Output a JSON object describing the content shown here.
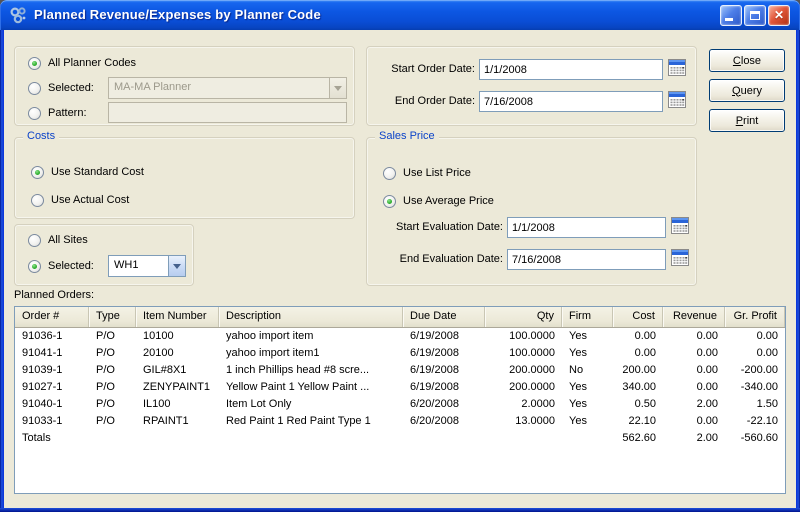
{
  "window": {
    "title": "Planned Revenue/Expenses by Planner Code"
  },
  "planner": {
    "all_label": "All Planner Codes",
    "selected_label": "Selected:",
    "selected_value": "MA-MA Planner",
    "pattern_label": "Pattern:",
    "pattern_value": ""
  },
  "order_dates": {
    "start_label": "Start Order Date:",
    "start_value": "1/1/2008",
    "end_label": "End Order Date:",
    "end_value": "7/16/2008"
  },
  "actions": {
    "close": "Close",
    "query": "Query",
    "print": "Print"
  },
  "costs": {
    "title": "Costs",
    "standard_label": "Use Standard Cost",
    "actual_label": "Use Actual Cost"
  },
  "sales_price": {
    "title": "Sales Price",
    "list_label": "Use List Price",
    "average_label": "Use Average Price",
    "start_label": "Start Evaluation Date:",
    "start_value": "1/1/2008",
    "end_label": "End Evaluation Date:",
    "end_value": "7/16/2008"
  },
  "sites": {
    "all_label": "All Sites",
    "selected_label": "Selected:",
    "selected_value": "WH1"
  },
  "state": {
    "planner_all_checked": true,
    "planner_selected_checked": false,
    "planner_pattern_checked": false,
    "costs_standard_checked": true,
    "costs_actual_checked": false,
    "price_list_checked": false,
    "price_average_checked": true,
    "sites_all_checked": false,
    "sites_selected_checked": true
  },
  "orders": {
    "section_label": "Planned Orders:",
    "columns": [
      "Order #",
      "Type",
      "Item Number",
      "Description",
      "Due Date",
      "Qty",
      "Firm",
      "Cost",
      "Revenue",
      "Gr. Profit"
    ],
    "rows": [
      [
        "91036-1",
        "P/O",
        "10100",
        "yahoo import item",
        "6/19/2008",
        "100.0000",
        "Yes",
        "0.00",
        "0.00",
        "0.00"
      ],
      [
        "91041-1",
        "P/O",
        "20100",
        "yahoo import item1",
        "6/19/2008",
        "100.0000",
        "Yes",
        "0.00",
        "0.00",
        "0.00"
      ],
      [
        "91039-1",
        "P/O",
        "GIL#8X1",
        "1 inch Phillips head #8 scre...",
        "6/19/2008",
        "200.0000",
        "No",
        "200.00",
        "0.00",
        "-200.00"
      ],
      [
        "91027-1",
        "P/O",
        "ZENYPAINT1",
        "Yellow Paint 1  Yellow Paint ...",
        "6/19/2008",
        "200.0000",
        "Yes",
        "340.00",
        "0.00",
        "-340.00"
      ],
      [
        "91040-1",
        "P/O",
        "IL100",
        "Item Lot Only",
        "6/20/2008",
        "2.0000",
        "Yes",
        "0.50",
        "2.00",
        "1.50"
      ],
      [
        "91033-1",
        "P/O",
        "RPAINT1",
        "Red Paint 1 Red Paint Type 1",
        "6/20/2008",
        "13.0000",
        "Yes",
        "22.10",
        "0.00",
        "-22.10"
      ]
    ],
    "totals": {
      "label": "Totals",
      "cost": "562.60",
      "revenue": "2.00",
      "gr_profit": "-560.60"
    }
  }
}
